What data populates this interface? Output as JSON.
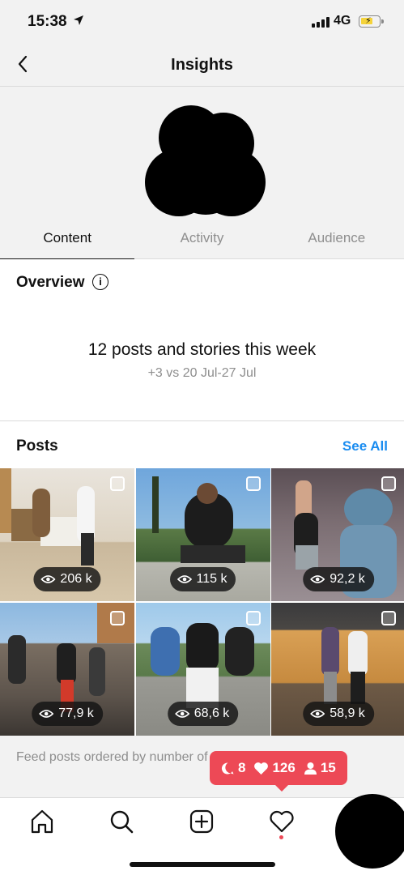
{
  "status_bar": {
    "time": "15:38",
    "network": "4G",
    "battery_color": "#f5d33a"
  },
  "nav": {
    "title": "Insights",
    "back_icon": "chevron-left-icon"
  },
  "tabs": [
    {
      "label": "Content",
      "active": true
    },
    {
      "label": "Activity",
      "active": false
    },
    {
      "label": "Audience",
      "active": false
    }
  ],
  "overview": {
    "title": "Overview",
    "info_icon": "i",
    "headline": "12 posts and stories this week",
    "comparison": "+3 vs 20 Jul-27 Jul"
  },
  "posts": {
    "title": "Posts",
    "see_all": "See All",
    "items": [
      {
        "views": "206 k"
      },
      {
        "views": "115 k"
      },
      {
        "views": "92,2 k"
      },
      {
        "views": "77,9 k"
      },
      {
        "views": "68,6 k"
      },
      {
        "views": "58,9 k"
      }
    ],
    "footer_note": "Feed posts ordered by number of times they were seen."
  },
  "notification": {
    "comments": "8",
    "likes": "126",
    "followers": "15"
  },
  "colors": {
    "accent": "#1a8cf0",
    "notification": "#ed4956"
  }
}
